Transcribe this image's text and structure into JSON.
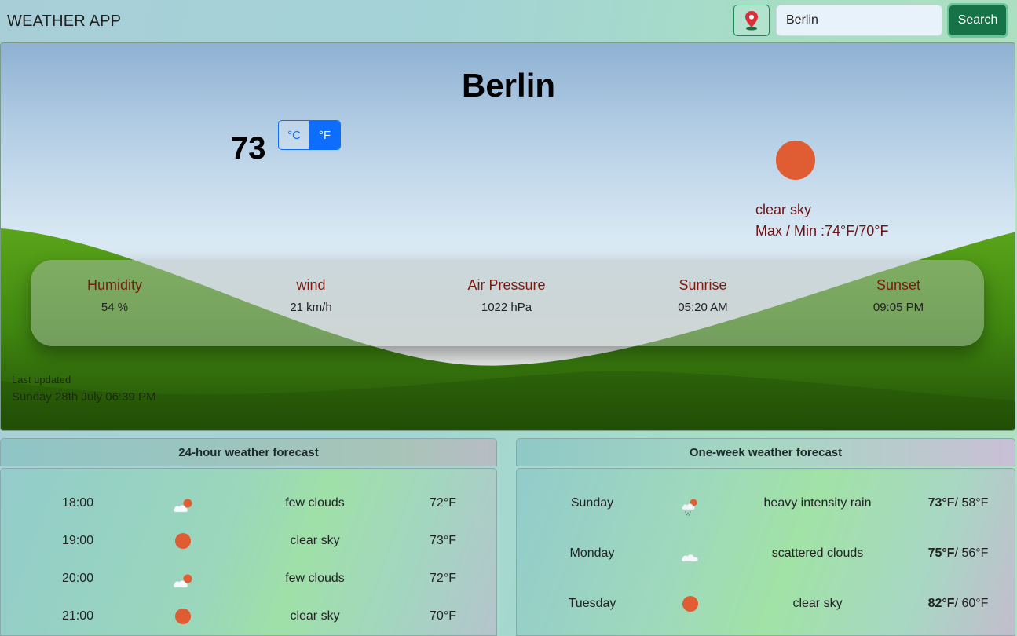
{
  "header": {
    "app_title": "WEATHER APP",
    "location_icon": "map-pin-icon",
    "search_value": "Berlin",
    "search_button": "Search"
  },
  "current": {
    "city": "Berlin",
    "temperature": "73",
    "unit_c": "°C",
    "unit_f": "°F",
    "selected_unit": "°F",
    "condition": "clear sky",
    "condition_icon": "sun-icon",
    "max_min": "Max / Min :74°F/70°F",
    "stats": [
      {
        "label": "Humidity",
        "value": "54 %"
      },
      {
        "label": "wind",
        "value": "21 km/h"
      },
      {
        "label": "Air Pressure",
        "value": "1022 hPa"
      },
      {
        "label": "Sunrise",
        "value": "05:20 AM"
      },
      {
        "label": "Sunset",
        "value": "09:05 PM"
      }
    ],
    "updated_label": "Last updated",
    "updated_value": "Sunday 28th July 06:39 PM"
  },
  "hourly": {
    "title": "24-hour weather forecast",
    "rows": [
      {
        "time": "18:00",
        "icon": "few-clouds-icon",
        "desc": "few clouds",
        "temp": "72°F"
      },
      {
        "time": "19:00",
        "icon": "sun-icon",
        "desc": "clear sky",
        "temp": "73°F"
      },
      {
        "time": "20:00",
        "icon": "few-clouds-icon",
        "desc": "few clouds",
        "temp": "72°F"
      },
      {
        "time": "21:00",
        "icon": "sun-icon",
        "desc": "clear sky",
        "temp": "70°F"
      }
    ]
  },
  "weekly": {
    "title": "One-week weather forecast",
    "rows": [
      {
        "day": "Sunday",
        "icon": "rain-icon",
        "desc": "heavy intensity rain",
        "high": "73°F",
        "low": "/ 58°F"
      },
      {
        "day": "Monday",
        "icon": "cloud-icon",
        "desc": "scattered clouds",
        "high": "75°F",
        "low": "/ 56°F"
      },
      {
        "day": "Tuesday",
        "icon": "sun-icon",
        "desc": "clear sky",
        "high": "82°F",
        "low": "/ 60°F"
      }
    ]
  },
  "colors": {
    "accent_blue": "#0d6efd",
    "search_green": "#157347",
    "sun": "#e05c33",
    "label_red": "#7a1a10"
  }
}
